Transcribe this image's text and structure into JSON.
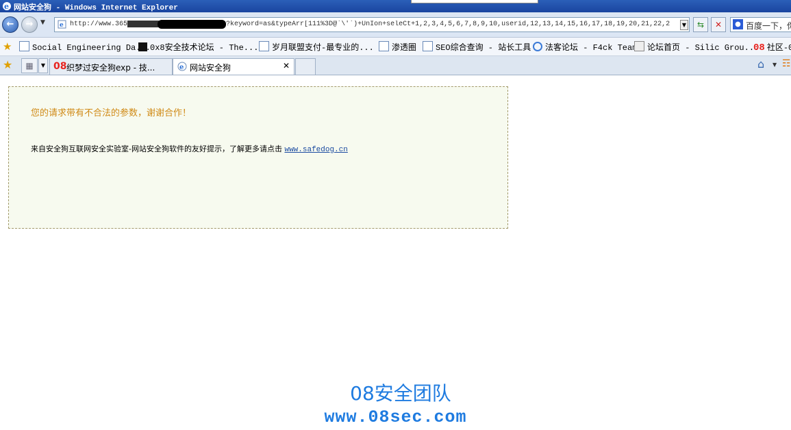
{
  "window": {
    "title": "网站安全狗 - Windows Internet Explorer"
  },
  "address": {
    "url": "http://www.365████████/plus/search.php?keyword=as&typeArr[111%3D@`\\'`)+UnIon+seleCt+1,2,3,4,5,6,7,8,9,10,userid,12,13,14,15,16,17,18,19,20,21,22,2"
  },
  "search": {
    "text": "百度一下，你"
  },
  "favorites": [
    {
      "label": "Social Engineering Da..."
    },
    {
      "label": "0x8安全技术论坛 - The..."
    },
    {
      "label": "岁月联盟支付-最专业的..."
    },
    {
      "label": "渗透圈"
    },
    {
      "label": "SEO综合查询 - 站长工具"
    },
    {
      "label": "法客论坛 - F4ck Team"
    },
    {
      "label": "论坛首页 - Silic Grou..."
    },
    {
      "label": "社区-0"
    }
  ],
  "tabs": [
    {
      "label": "织梦过安全狗exp - 技..."
    },
    {
      "label": "网站安全狗"
    }
  ],
  "page": {
    "warning": "您的请求带有不合法的参数，谢谢合作！",
    "info": "来自安全狗互联网安全实验室-网站安全狗软件的友好提示，了解更多请点击",
    "link": "www.safedog.cn"
  },
  "watermark": {
    "line1": "08安全团队",
    "line2": "www.08sec.com"
  },
  "colors": {
    "warning": "#d08a16",
    "watermark": "#1e7be0",
    "boxbg": "#f7faef"
  }
}
